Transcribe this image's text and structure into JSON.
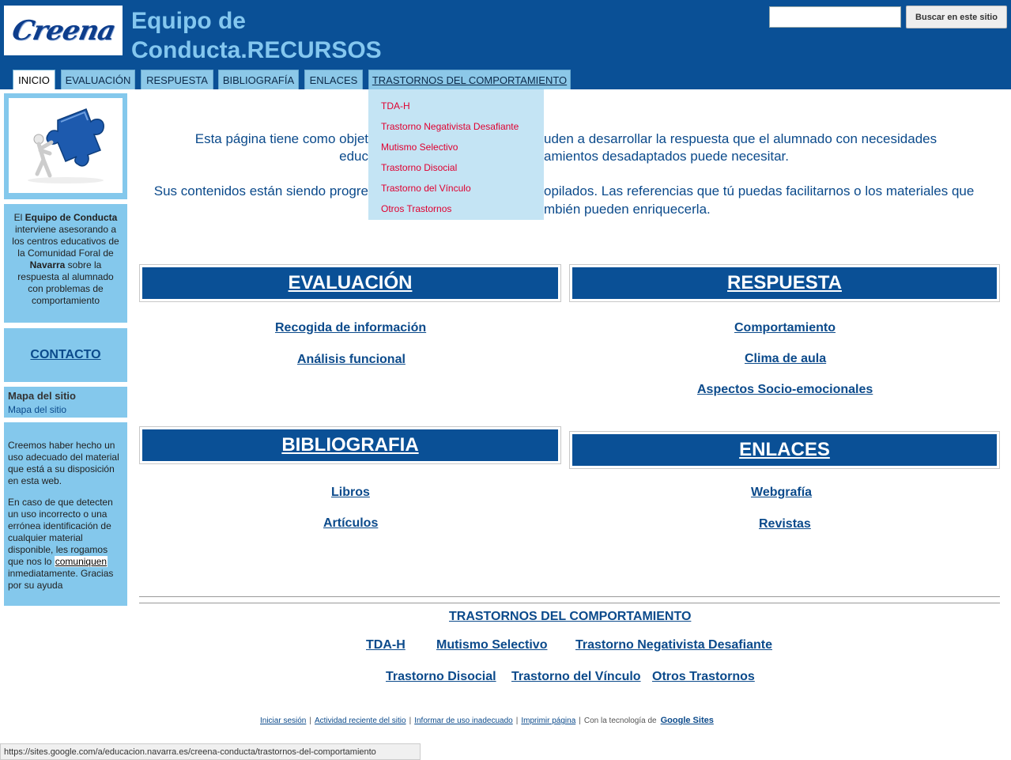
{
  "header": {
    "logo_text": "Creena",
    "title_line1": "Equipo de",
    "title_line2": "Conducta.RECURSOS",
    "search_button": "Buscar en este sitio"
  },
  "tabs": [
    {
      "label": "INICIO"
    },
    {
      "label": "EVALUACIÓN"
    },
    {
      "label": "RESPUESTA"
    },
    {
      "label": "BIBLIOGRAFÍA"
    },
    {
      "label": "ENLACES"
    },
    {
      "label": "TRASTORNOS DEL COMPORTAMIENTO"
    }
  ],
  "dropdown": [
    {
      "label": "TDA-H"
    },
    {
      "label": "Trastorno Negativista Desafiante"
    },
    {
      "label": "Mutismo Selectivo"
    },
    {
      "label": "Trastorno Disocial"
    },
    {
      "label": "Trastorno del Vínculo"
    },
    {
      "label": "Otros Trastornos"
    }
  ],
  "sidebar": {
    "info_p1": "El ",
    "info_b1": "Equipo de Conducta",
    "info_p2": " interviene asesorando a los centros educativos de la Comunidad Foral de ",
    "info_b2": "Navarra",
    "info_p3": " sobre la respuesta al alumnado con problemas de comportamiento",
    "contact": "CONTACTO",
    "map_title": "Mapa del sitio",
    "map_link": "Mapa del sitio",
    "note_p1": "Creemos haber hecho un uso adecuado del material que está a su disposición en esta web.",
    "note_p2a": "En caso de que detecten un uso incorrecto o una errónea identificación de cualquier material disponible, les rogamos que nos lo ",
    "note_link": "comuniquen",
    "note_p2b": " inmediatamente. Gracias por su ayuda"
  },
  "intro": {
    "l1a": "Esta página tiene como objet",
    "l1b": "uden a desarrollar la respuesta que el alumnado con necesidades",
    "l2a": "educ",
    "l2b": "amientos desadaptados puede necesitar.",
    "l3a": "Sus contenidos están siendo progre",
    "l3b": "opilados. Las referencias que tú puedas facilitarnos o los materiales que",
    "l4b": "mbién pueden enriquecerla."
  },
  "sections": {
    "evaluacion": {
      "title": "EVALUACIÓN",
      "links": [
        "Recogida de información",
        "Análisis funcional"
      ]
    },
    "respuesta": {
      "title": "RESPUESTA",
      "links": [
        "Comportamiento",
        "Clima de aula",
        "Aspectos Socio-emocionales"
      ]
    },
    "bibliografia": {
      "title": "BIBLIOGRAFIA",
      "links": [
        "Libros",
        "Artículos"
      ]
    },
    "enlaces": {
      "title": "ENLACES",
      "links": [
        "Webgrafía",
        "Revistas"
      ]
    }
  },
  "trastornos": {
    "title": "TRASTORNOS DEL COMPORTAMIENTO",
    "row1": [
      "TDA-H",
      "Mutismo Selectivo",
      "Trastorno Negativista Desafiante"
    ],
    "row2": [
      "Trastorno Disocial",
      "Trastorno del Vínculo",
      "Otros Trastornos"
    ]
  },
  "footer": {
    "links": [
      "Iniciar sesión",
      "Actividad reciente del sitio",
      "Informar de uso inadecuado",
      "Imprimir página"
    ],
    "powered": "Con la tecnología de",
    "google_sites": "Google Sites"
  },
  "status_url": "https://sites.google.com/a/educacion.navarra.es/creena-conducta/trastornos-del-comportamiento"
}
